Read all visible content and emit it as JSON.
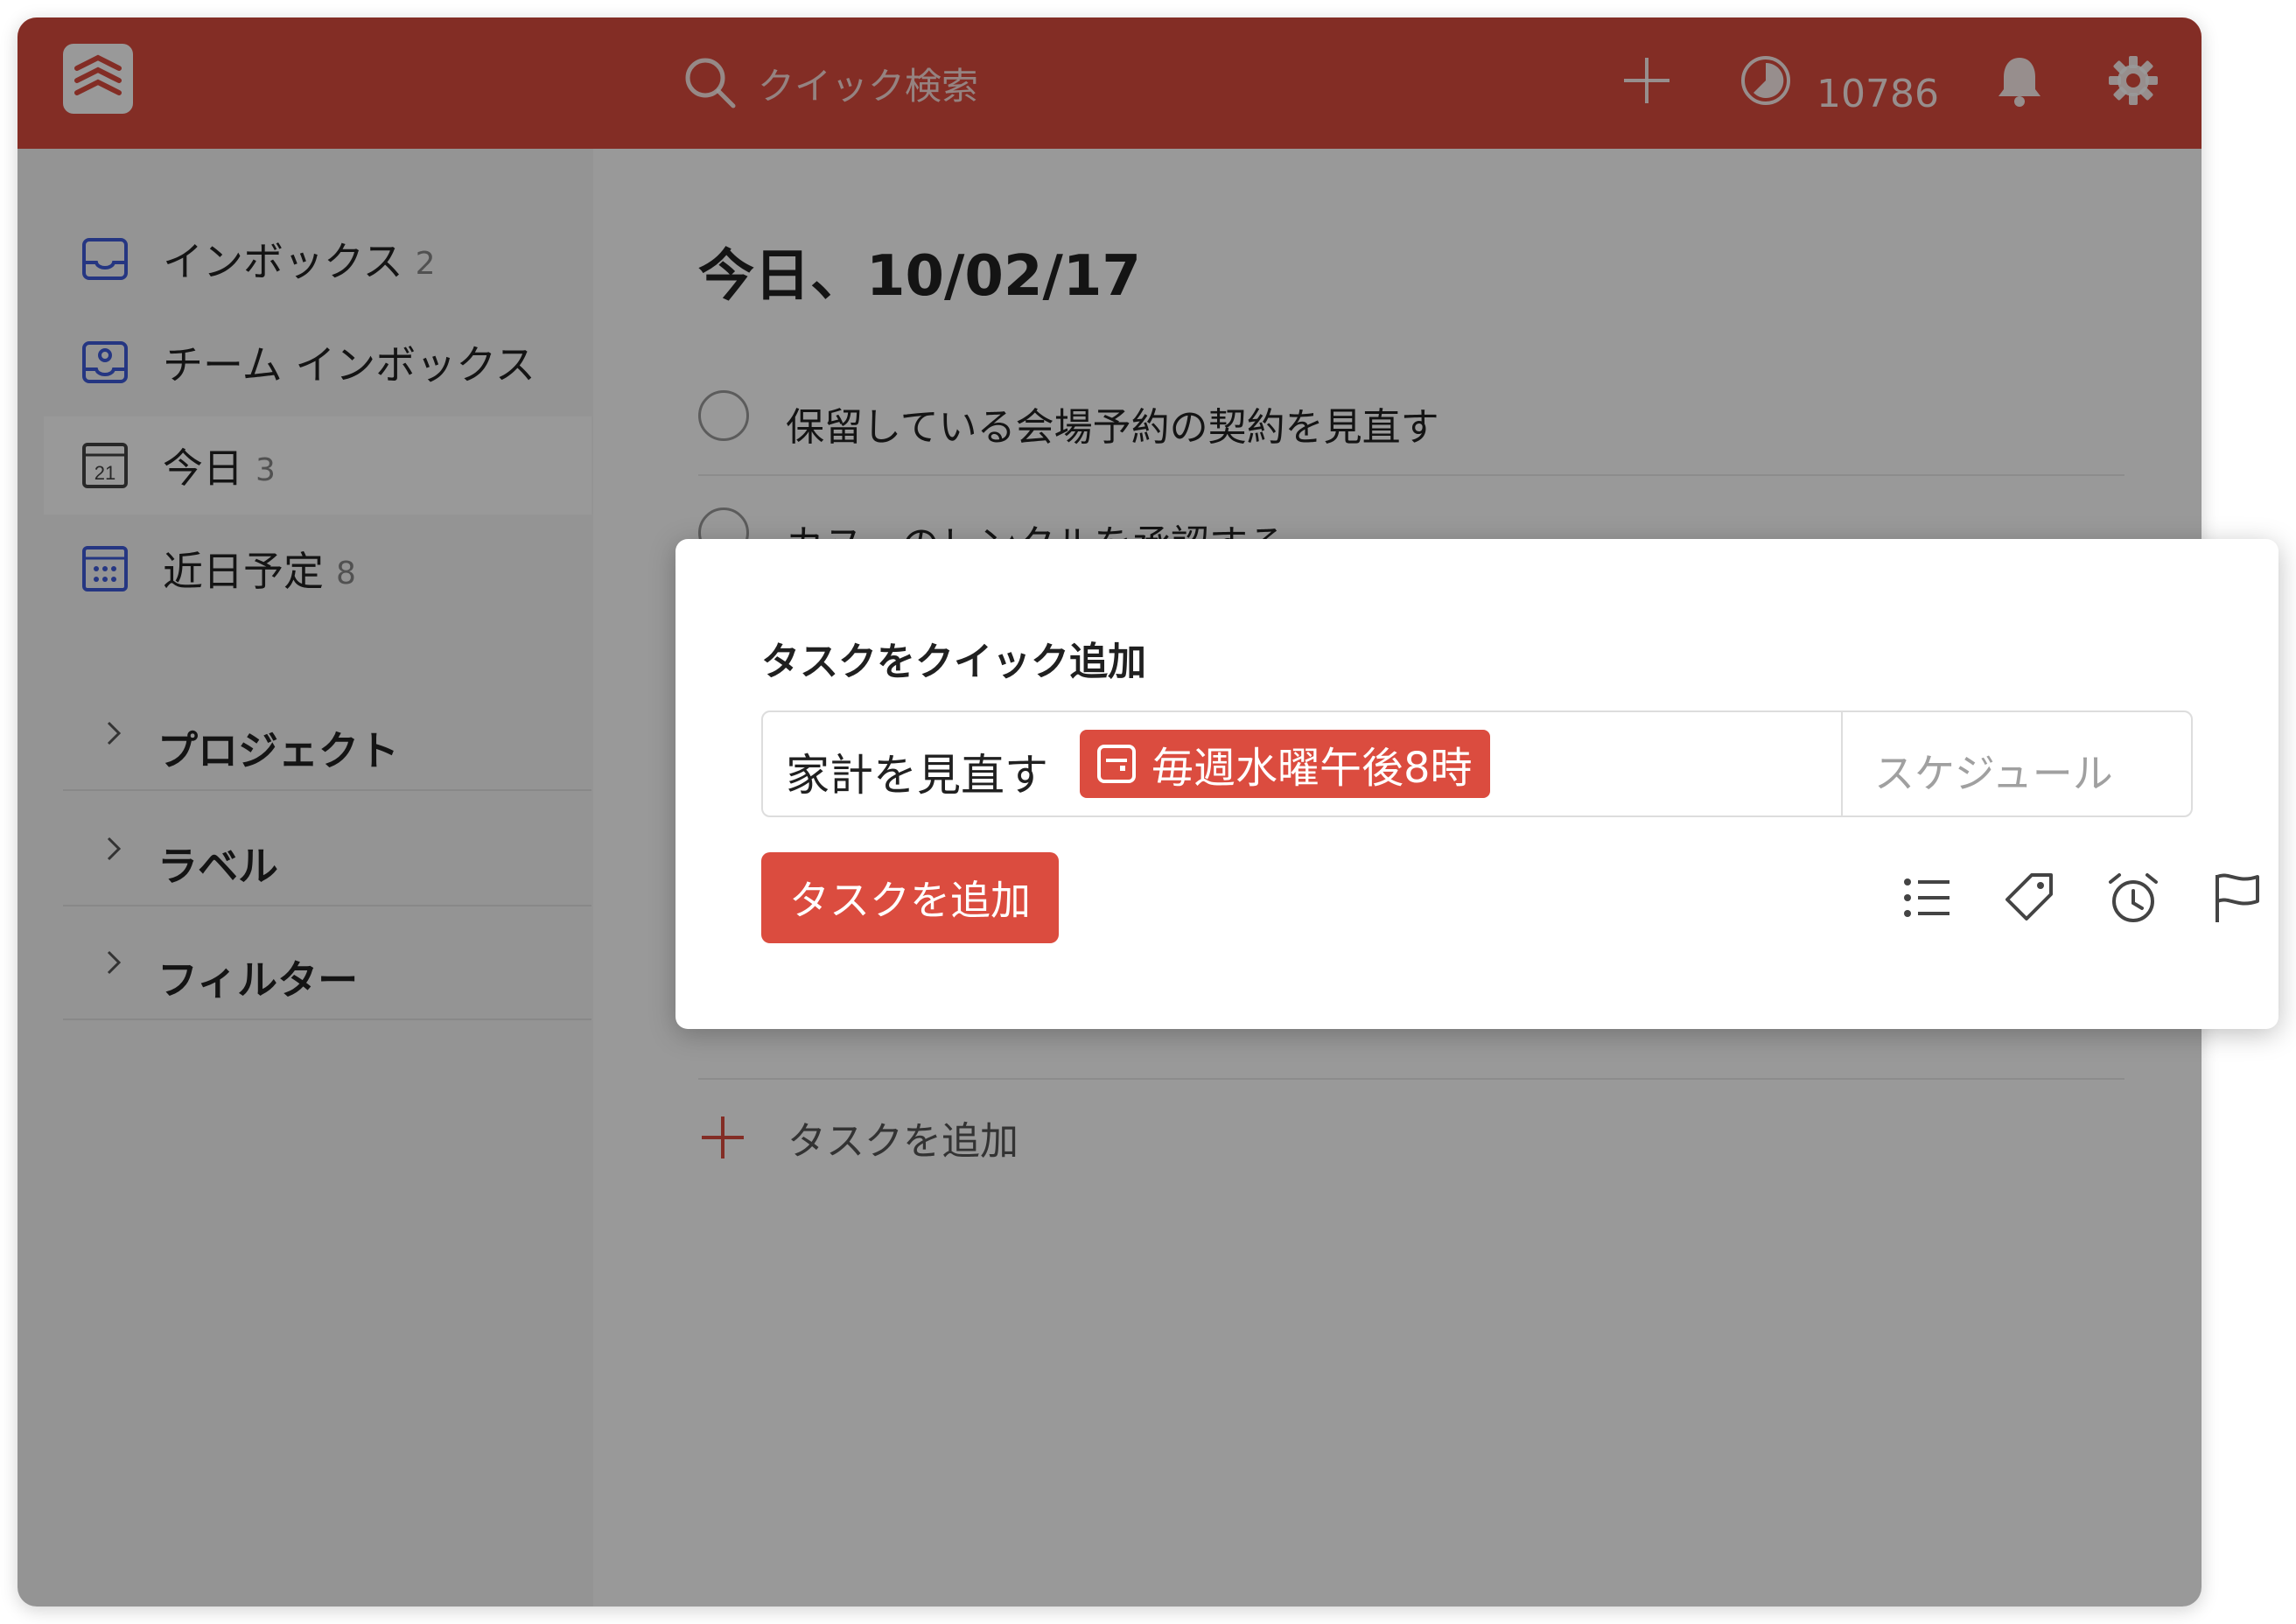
{
  "colors": {
    "brand": "#db4c3f",
    "sidebar_bg": "#f7f7f7",
    "overlay": "rgba(0,0,0,0.4)",
    "nav_icon": "#3e5bd9"
  },
  "header": {
    "logo_icon": "todoist-logo-icon",
    "search_placeholder": "クイック検索",
    "karma_value": "10786",
    "icons": [
      "search-icon",
      "plus-icon",
      "karma-icon",
      "bell-icon",
      "gear-icon"
    ]
  },
  "sidebar": {
    "items": [
      {
        "label": "インボックス",
        "count": "2",
        "icon": "inbox-icon"
      },
      {
        "label": "チーム インボックス",
        "count": "",
        "icon": "team-inbox-icon"
      },
      {
        "label": "今日",
        "count": "3",
        "icon": "calendar-today-icon"
      },
      {
        "label": "近日予定",
        "count": "8",
        "icon": "calendar-upcoming-icon"
      }
    ],
    "sections": [
      {
        "label": "プロジェクト"
      },
      {
        "label": "ラベル"
      },
      {
        "label": "フィルター"
      }
    ]
  },
  "main": {
    "title": "今日、10/02/17",
    "tasks": [
      {
        "text": "保留している会場予約の契約を見直す"
      },
      {
        "text": "カヌーのレンタルを承認する"
      }
    ],
    "add_task_label": "タスクを追加"
  },
  "quick_add": {
    "title": "タスクをクイック追加",
    "input_text": "家計を見直す",
    "date_chip": "毎週水曜午後8時",
    "schedule_placeholder": "スケジュール",
    "submit_label": "タスクを追加",
    "tool_icons": [
      "project-list-icon",
      "label-tag-icon",
      "reminder-alarm-icon",
      "priority-flag-icon",
      "comment-icon"
    ]
  }
}
